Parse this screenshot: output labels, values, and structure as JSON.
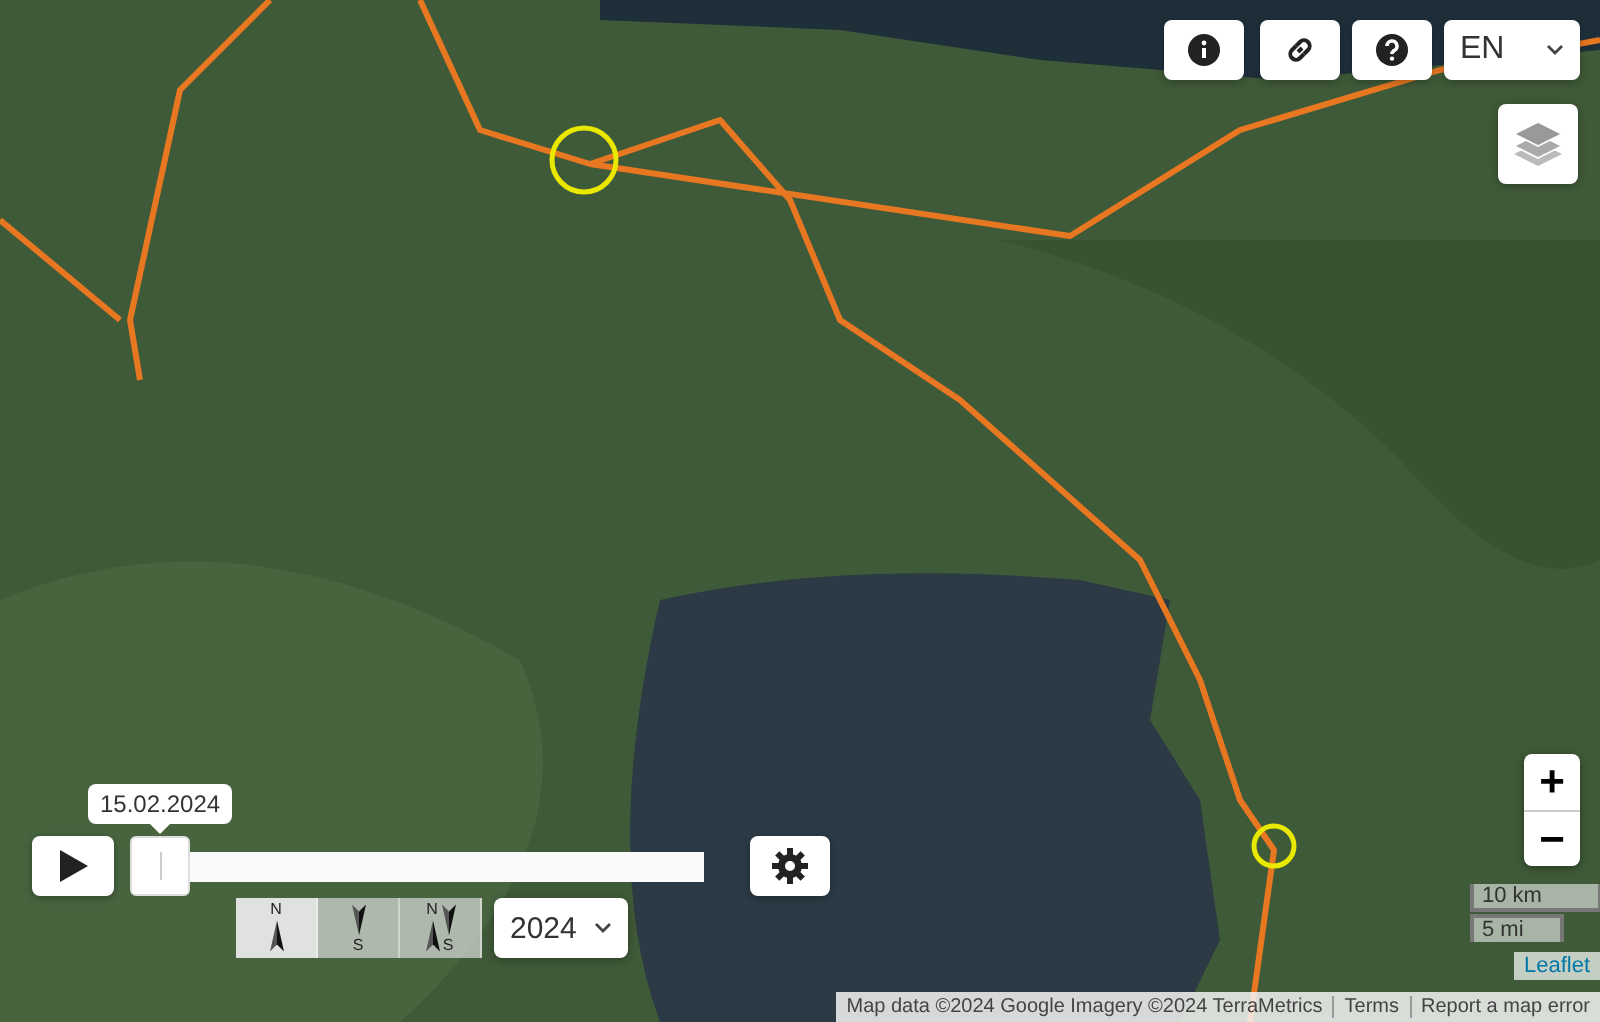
{
  "language": {
    "value": "EN"
  },
  "zoom": {
    "zoom_in": "+",
    "zoom_out": "−"
  },
  "timeline": {
    "date": "15.02.2024",
    "level": 0
  },
  "direction_modes": [
    {
      "kind": "north",
      "label": "N",
      "selected": true
    },
    {
      "kind": "south",
      "label": "S",
      "selected": false
    },
    {
      "kind": "both",
      "label": "N",
      "label_2": "S",
      "selected": false
    }
  ],
  "year_select": {
    "value": "2024"
  },
  "scale": {
    "metric": "10 km",
    "imperial": "5 mi"
  },
  "attribution": {
    "library": "Leaflet",
    "map_data": "Map data ©2024 Google Imagery ©2024 TerraMetrics",
    "terms": "Terms",
    "report": "Report a map error"
  }
}
